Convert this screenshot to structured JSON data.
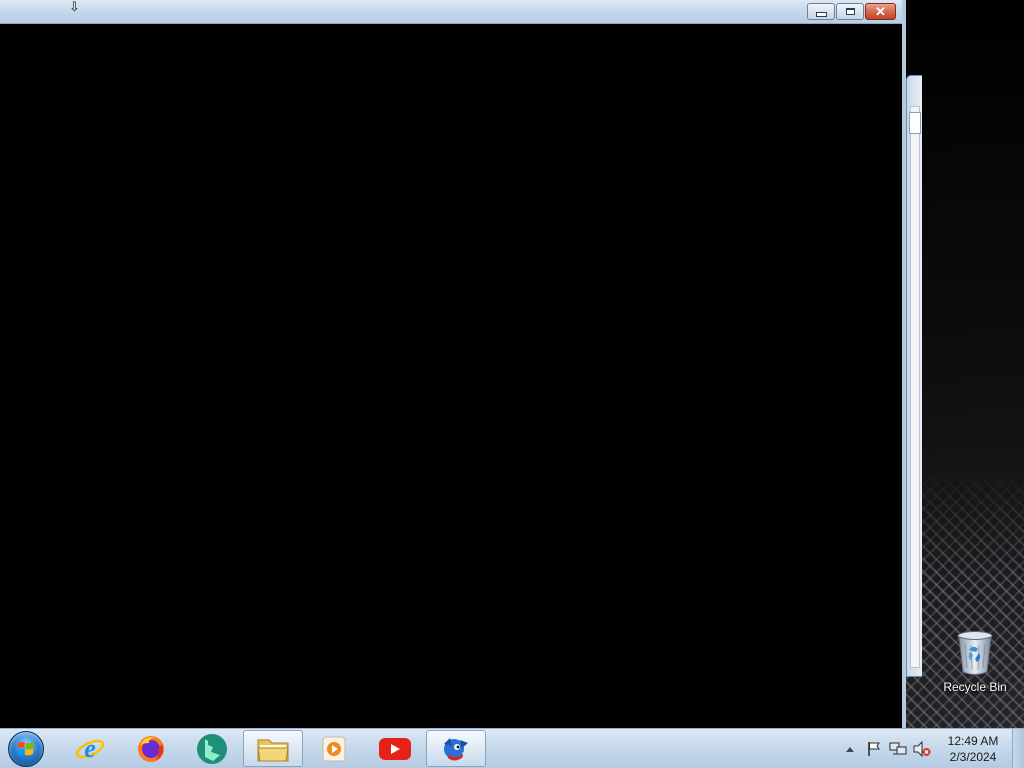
{
  "desktop": {
    "icons": [
      {
        "label": "Recycle Bin",
        "icon": "recycle-bin-icon"
      }
    ]
  },
  "window": {
    "title": "",
    "controls": {
      "minimize": "minimize-icon",
      "maximize": "maximize-icon",
      "close": "close-icon"
    }
  },
  "taskbar": {
    "start": {
      "icon": "windows-start-orb-icon"
    },
    "pinned": [
      {
        "name": "internet-explorer",
        "icon": "internet-explorer-icon",
        "running": false
      },
      {
        "name": "firefox",
        "icon": "firefox-icon",
        "running": false
      },
      {
        "name": "bing",
        "icon": "bing-icon",
        "running": false
      },
      {
        "name": "file-explorer",
        "icon": "folder-icon",
        "running": true
      },
      {
        "name": "media-player",
        "icon": "media-player-icon",
        "running": false
      },
      {
        "name": "youtube",
        "icon": "youtube-icon",
        "running": false
      },
      {
        "name": "game-app",
        "icon": "game-icon",
        "running": true
      }
    ],
    "tray": {
      "icons": [
        "show-hidden-icons-icon",
        "action-center-flag-icon",
        "network-icon",
        "volume-muted-icon"
      ],
      "time": "12:49 AM",
      "date": "2/3/2024"
    }
  },
  "colors": {
    "taskbar_top": "#dde9f5",
    "taskbar_bottom": "#b5cbe2",
    "window_client": "#000000",
    "close_button": "#c0432b"
  }
}
